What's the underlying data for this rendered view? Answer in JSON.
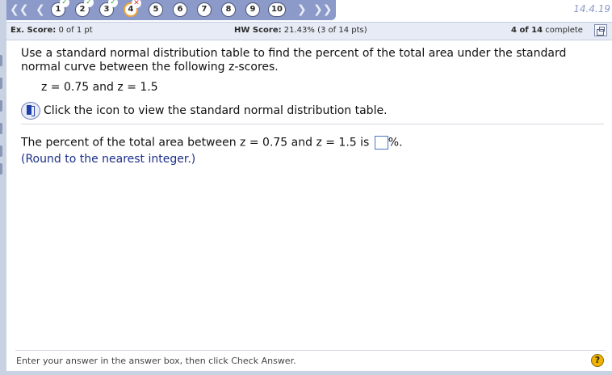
{
  "nav": {
    "questions": [
      {
        "label": "1",
        "status": "correct"
      },
      {
        "label": "2",
        "status": "correct"
      },
      {
        "label": "3",
        "status": "correct"
      },
      {
        "label": "4",
        "status": "incorrect",
        "current": true
      },
      {
        "label": "5"
      },
      {
        "label": "6"
      },
      {
        "label": "7"
      },
      {
        "label": "8"
      },
      {
        "label": "9"
      },
      {
        "label": "10"
      }
    ],
    "version": "14.4.19"
  },
  "score": {
    "ex_label": "Ex. Score:",
    "ex_value": "0 of 1 pt",
    "hw_label": "HW Score:",
    "hw_value": "21.43% (3 of 14 pts)",
    "progress_count": "4 of 14",
    "progress_label": "complete"
  },
  "question": {
    "prompt": "Use a standard normal distribution table to find the percent of the total area under the standard normal curve between the following z-scores.",
    "zscores": "z = 0.75 and z = 1.5",
    "table_link": "Click the icon to view the standard normal distribution table.",
    "answer_prefix": "The percent of the total area between z = 0.75 and z = 1.5 is",
    "answer_value": "",
    "answer_suffix": "%.",
    "note": "(Round to the nearest integer.)"
  },
  "footer": {
    "instruction": "Enter your answer in the answer box, then click Check Answer.",
    "help_symbol": "?"
  },
  "colors": {
    "nav_bg": "#8b9ac8",
    "score_bg": "#e6ebf5",
    "current_ring": "#f2a33a",
    "correct": "#3fa53f",
    "incorrect": "#dd3333",
    "note": "#1a2f8a"
  }
}
